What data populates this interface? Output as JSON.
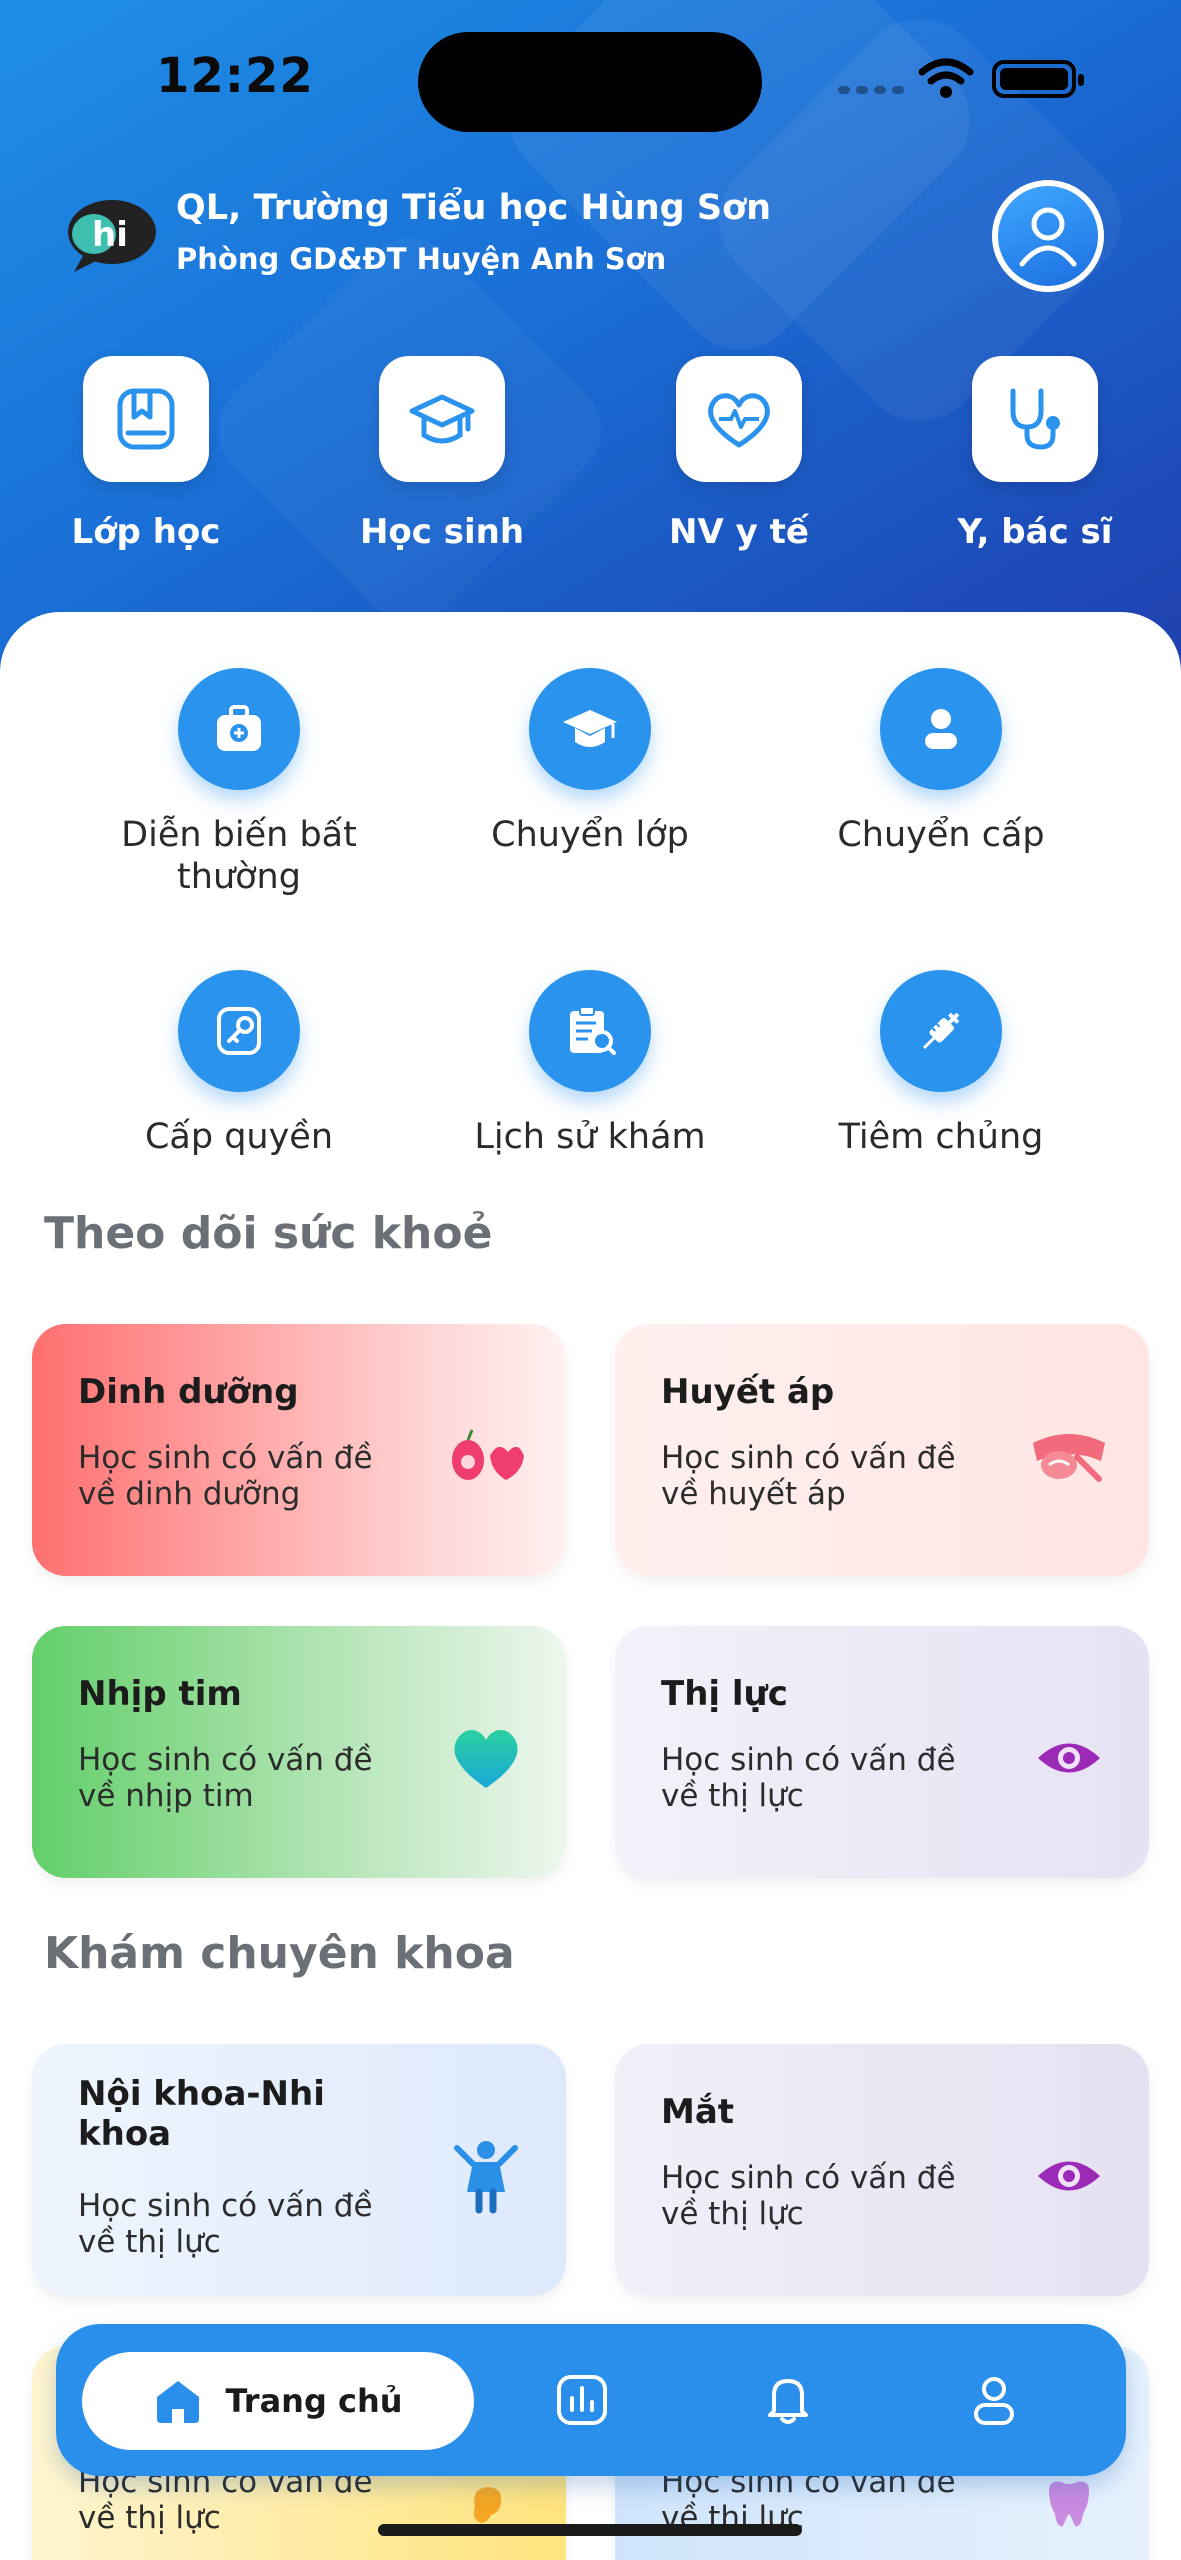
{
  "status_bar": {
    "time": "12:22"
  },
  "header": {
    "school_name": "QL, Trường Tiểu học Hùng Sơn",
    "department": "Phòng GD&ĐT Huyện Anh Sơn",
    "logo_icon": "hi-chat-logo-icon",
    "avatar_icon": "user-avatar-icon"
  },
  "quick_actions": [
    {
      "label": "Lớp học",
      "icon": "class-book-icon"
    },
    {
      "label": "Học sinh",
      "icon": "graduation-cap-icon"
    },
    {
      "label": "NV y tế",
      "icon": "heart-pulse-icon"
    },
    {
      "label": "Y, bác sĩ",
      "icon": "stethoscope-icon"
    }
  ],
  "features": [
    {
      "label": "Diễn biến bất thường",
      "icon": "medical-kit-icon"
    },
    {
      "label": "Chuyển lớp",
      "icon": "graduation-cap-icon"
    },
    {
      "label": "Chuyển cấp",
      "icon": "person-icon"
    },
    {
      "label": "Cấp quyền",
      "icon": "key-icon"
    },
    {
      "label": "Lịch sử khám",
      "icon": "clipboard-search-icon"
    },
    {
      "label": "Tiêm chủng",
      "icon": "syringe-icon"
    }
  ],
  "health_section": {
    "title": "Theo dõi sức khoẻ",
    "cards": [
      {
        "title": "Dinh dưỡng",
        "desc": "Học sinh có vấn đề về dinh dưỡng",
        "icon": "fruit-icon"
      },
      {
        "title": "Huyết áp",
        "desc": "Học sinh có vấn đề về huyết áp",
        "icon": "blood-pressure-icon"
      },
      {
        "title": "Nhịp tim",
        "desc": "Học sinh có vấn đề về nhịp tim",
        "icon": "heart-icon"
      },
      {
        "title": "Thị lực",
        "desc": "Học sinh có vấn đề về thị lực",
        "icon": "eye-icon"
      }
    ]
  },
  "specialist_section": {
    "title": "Khám chuyên khoa",
    "cards": [
      {
        "title": "Nội khoa-Nhi khoa",
        "desc": "Học sinh có vấn đề về thị lực",
        "icon": "child-icon"
      },
      {
        "title": "Mắt",
        "desc": "Học sinh có vấn đề về thị lực",
        "icon": "eye-icon"
      },
      {
        "title": "",
        "desc": "Học sinh có vấn đề về thị lực",
        "icon": "ear-icon"
      },
      {
        "title": "",
        "desc": "Học sinh có vấn đề về thị lực",
        "icon": "tooth-icon"
      }
    ]
  },
  "bottom_nav": {
    "home_label": "Trang chủ",
    "items": [
      "home-icon",
      "chart-icon",
      "bell-icon",
      "profile-icon"
    ]
  },
  "colors": {
    "primary": "#2a93ee",
    "header_start": "#1e8fe6",
    "header_end": "#1e3fae"
  }
}
